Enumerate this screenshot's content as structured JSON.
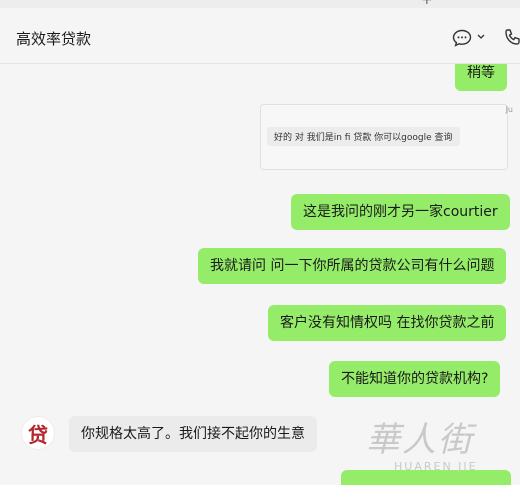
{
  "window": {
    "plus_glyph": "+"
  },
  "header": {
    "title": "高效率贷款"
  },
  "messages": [
    {
      "id": "m0",
      "side": "right",
      "text": "稍等"
    },
    {
      "id": "m1",
      "side": "right",
      "type": "quote",
      "timestamp": "Ju",
      "text": "好的 对 我们是in fi 贷款 你可以google 查询"
    },
    {
      "id": "m2",
      "side": "right",
      "text": "这是我问的刚才另一家courtier"
    },
    {
      "id": "m3",
      "side": "right",
      "text": "我就请问 问一下你所属的贷款公司有什么问题"
    },
    {
      "id": "m4",
      "side": "right",
      "text": "客户没有知情权吗 在找你贷款之前"
    },
    {
      "id": "m5",
      "side": "right",
      "text": "不能知道你的贷款机构?"
    },
    {
      "id": "m6",
      "side": "left",
      "text": "你规格太高了。我们接不起你的生意"
    }
  ],
  "avatar": {
    "glyph": "贷",
    "color": "#b3262d"
  },
  "watermark": {
    "logo": "華人街",
    "text": "HUAREN JIE"
  },
  "colors": {
    "bubble_self": "#95ec69",
    "bubble_other": "#ebebeb",
    "background": "#f5f5f5"
  }
}
